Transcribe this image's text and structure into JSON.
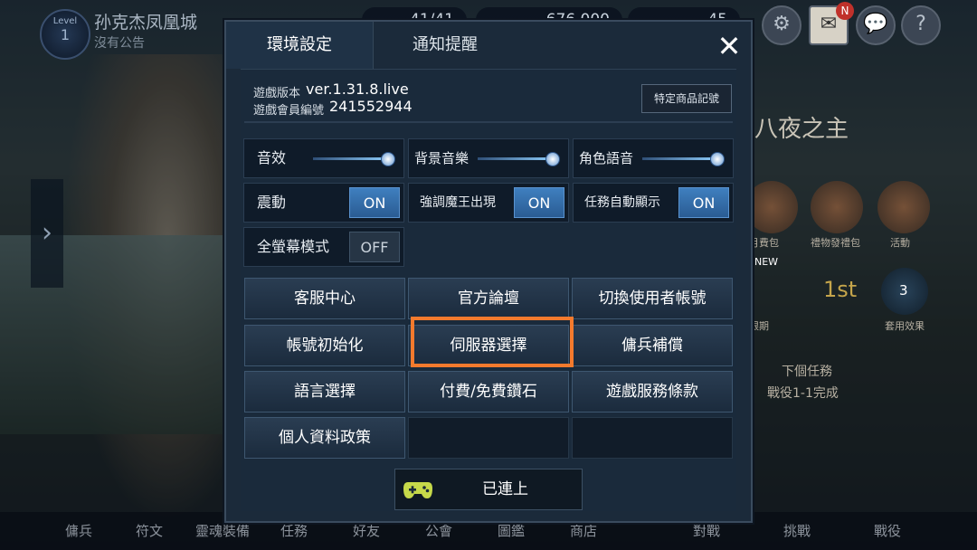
{
  "status_bar": {
    "level_label": "Level",
    "level_value": "1",
    "guild_name": "孙克杰凤凰城",
    "guild_notice": "沒有公告",
    "stamina": "41/41",
    "gold": "676,000",
    "gems": "45",
    "mail_badge": "N"
  },
  "background": {
    "banner_text": "八夜之主",
    "next_task_label": "下個任務",
    "next_task_value": "戰役1-1完成",
    "feature_labels": [
      "月費包",
      "禮物發禮包",
      "活動",
      "限期",
      "套用效果"
    ],
    "badge_1st": "1st",
    "new_badge": "NEW",
    "circle_num": "3"
  },
  "bottom_nav": [
    "傭兵",
    "符文",
    "靈魂裝備",
    "任務",
    "好友",
    "公會",
    "圖鑑",
    "商店",
    "對戰",
    "挑戰",
    "戰役"
  ],
  "dialog": {
    "tabs": {
      "settings": "環境設定",
      "notify": "通知提醒"
    },
    "close_icon": "close-icon",
    "version_label": "遊戲版本",
    "version_value": "ver.1.31.8.live",
    "member_label": "遊戲會員編號",
    "member_value": "241552944",
    "special_button": "特定商品記號",
    "sliders": [
      {
        "label": "音效",
        "value": 1.0
      },
      {
        "label": "背景音樂",
        "value": 1.0
      },
      {
        "label": "角色語音",
        "value": 1.0
      }
    ],
    "toggles": [
      {
        "label": "震動",
        "state": "ON"
      },
      {
        "label": "強調魔王出現",
        "state": "ON"
      },
      {
        "label": "任務自動顯示",
        "state": "ON"
      },
      {
        "label": "全螢幕模式",
        "state": "OFF"
      }
    ],
    "buttons": [
      "客服中心",
      "官方論壇",
      "切換使用者帳號",
      "帳號初始化",
      "伺服器選擇",
      "傭兵補償",
      "語言選擇",
      "付費/免費鑽石",
      "遊戲服務條款",
      "個人資料政策"
    ],
    "connected_label": "已連上",
    "highlight_color": "#f47a2d",
    "accent_on": "#3f7fbf"
  }
}
